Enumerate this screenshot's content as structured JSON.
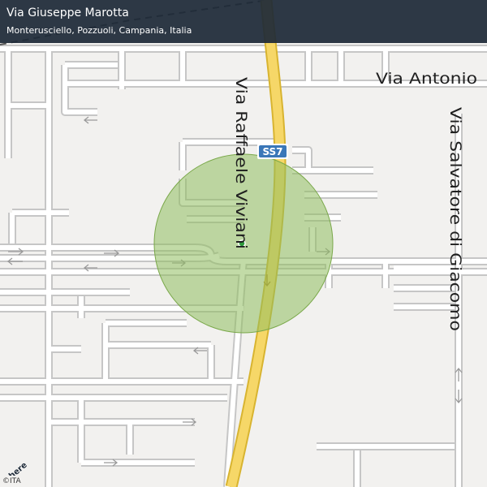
{
  "header": {
    "title": "Via Giuseppe Marotta",
    "subtitle": "Monterusciello, Pozzuoli, Campania, Italia"
  },
  "map": {
    "street_labels": {
      "raffaele_viviani": "Via Raffaele Viviani",
      "salvatore_di_giacomo": "Via Salvatore di Giacomo",
      "antonio": "Via Antonio"
    },
    "road_shield": "SS7",
    "logo": "here",
    "attribution": "©ITA",
    "colors": {
      "background": "#f2f1ef",
      "street_casing": "#c6c6c6",
      "highway_fill": "#f6d768",
      "highway_casing": "#d8b430",
      "shield": "#3a77b8",
      "radius_fill": "#8fbd5e",
      "radius_stroke": "#7aa84a",
      "marker": "#2f9a3c"
    }
  }
}
